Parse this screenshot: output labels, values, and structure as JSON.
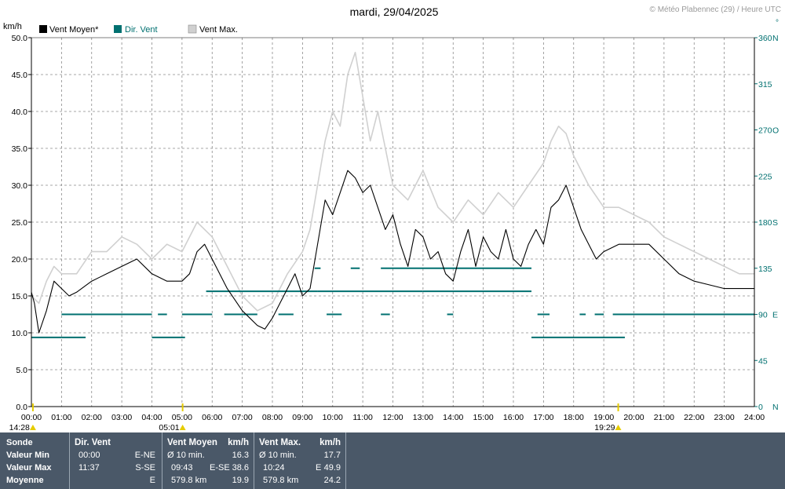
{
  "chart_data": {
    "type": "line",
    "title": "mardi, 29/04/2025",
    "credit": "© Météo Plabennec (29) / Heure UTC",
    "ylabel": "km/h",
    "legend": [
      {
        "label": "Vent Moyen*",
        "color": "#000000"
      },
      {
        "label": "Dir. Vent",
        "color": "#007070"
      },
      {
        "label": "Vent Max.",
        "color": "#d0d0d0"
      }
    ],
    "legend_placement": "top-left",
    "grid": true,
    "ylim": [
      0,
      50
    ],
    "y2lim": [
      0,
      360
    ],
    "xlim": [
      0,
      24
    ],
    "x_ticks": [
      "00:00",
      "01:00",
      "02:00",
      "03:00",
      "04:00",
      "05:00",
      "06:00",
      "07:00",
      "08:00",
      "09:00",
      "10:00",
      "11:00",
      "12:00",
      "13:00",
      "14:00",
      "15:00",
      "16:00",
      "17:00",
      "18:00",
      "19:00",
      "20:00",
      "21:00",
      "22:00",
      "23:00",
      "24:00"
    ],
    "y_ticks": [
      "0.0",
      "5.0",
      "10.0",
      "15.0",
      "20.0",
      "25.0",
      "30.0",
      "35.0",
      "40.0",
      "45.0",
      "50.0"
    ],
    "y2_ticks": [
      {
        "value": 0,
        "label": "0",
        "dir": "N"
      },
      {
        "value": 45,
        "label": "45",
        "dir": ""
      },
      {
        "value": 90,
        "label": "90",
        "dir": "E"
      },
      {
        "value": 135,
        "label": "135",
        "dir": ""
      },
      {
        "value": 180,
        "label": "180",
        "dir": "S"
      },
      {
        "value": 225,
        "label": "225",
        "dir": ""
      },
      {
        "value": 270,
        "label": "270",
        "dir": "O"
      },
      {
        "value": 315,
        "label": "315",
        "dir": ""
      },
      {
        "value": 360,
        "label": "360",
        "dir": "N"
      }
    ],
    "y2_top_mark": "°",
    "sun_events": [
      {
        "label": "14:28",
        "hour": 0.05,
        "note": "moon"
      },
      {
        "label": "05:01",
        "hour": 5.02,
        "note": "sunrise"
      },
      {
        "label": "19:29",
        "hour": 19.48,
        "note": "sunset"
      }
    ],
    "series": [
      {
        "name": "Vent Max.",
        "x": [
          0,
          0.25,
          0.5,
          0.75,
          1,
          1.5,
          2,
          2.5,
          3,
          3.5,
          4,
          4.5,
          5,
          5.5,
          6,
          6.5,
          7,
          7.5,
          8,
          8.5,
          9,
          9.25,
          9.5,
          9.75,
          10,
          10.25,
          10.5,
          10.75,
          11,
          11.25,
          11.5,
          11.75,
          12,
          12.5,
          13,
          13.5,
          14,
          14.5,
          15,
          15.5,
          16,
          16.5,
          17,
          17.25,
          17.5,
          17.75,
          18,
          18.5,
          19,
          19.5,
          20,
          20.5,
          21,
          21.5,
          22,
          22.5,
          23,
          23.5,
          24
        ],
        "values": [
          15,
          14,
          17,
          19,
          18,
          18,
          21,
          21,
          23,
          22,
          20,
          22,
          21,
          25,
          23,
          19,
          15,
          13,
          14,
          18,
          21,
          24,
          30,
          36,
          40,
          38,
          45,
          48,
          42,
          36,
          40,
          35,
          30,
          28,
          32,
          27,
          25,
          28,
          26,
          29,
          27,
          30,
          33,
          36,
          38,
          37,
          34,
          30,
          27,
          27,
          26,
          25,
          23,
          22,
          21,
          20,
          19,
          18,
          18
        ]
      },
      {
        "name": "Vent Moyen*",
        "x": [
          0,
          0.1,
          0.25,
          0.5,
          0.75,
          1,
          1.25,
          1.5,
          2,
          2.5,
          3,
          3.5,
          4,
          4.5,
          5,
          5.25,
          5.5,
          5.75,
          6,
          6.5,
          7,
          7.25,
          7.5,
          7.75,
          8,
          8.25,
          8.5,
          8.75,
          9,
          9.25,
          9.5,
          9.75,
          10,
          10.25,
          10.5,
          10.75,
          11,
          11.25,
          11.5,
          11.75,
          12,
          12.25,
          12.5,
          12.75,
          13,
          13.25,
          13.5,
          13.75,
          14,
          14.25,
          14.5,
          14.75,
          15,
          15.25,
          15.5,
          15.75,
          16,
          16.25,
          16.5,
          16.75,
          17,
          17.25,
          17.5,
          17.75,
          18,
          18.25,
          18.5,
          18.75,
          19,
          19.5,
          20,
          20.5,
          21,
          21.5,
          22,
          22.5,
          23,
          23.5,
          24
        ],
        "values": [
          15.5,
          14,
          10,
          13,
          17,
          16,
          15,
          15.5,
          17,
          18,
          19,
          20,
          18,
          17,
          17,
          18,
          21,
          22,
          20,
          16,
          13,
          12,
          11,
          10.5,
          12,
          14,
          16,
          18,
          15,
          16,
          22,
          28,
          26,
          29,
          32,
          31,
          29,
          30,
          27,
          24,
          26,
          22,
          19,
          24,
          23,
          20,
          21,
          18,
          17,
          21,
          24,
          19,
          23,
          21,
          20,
          24,
          20,
          19,
          22,
          24,
          22,
          27,
          28,
          30,
          27,
          24,
          22,
          20,
          21,
          22,
          22,
          22,
          20,
          18,
          17,
          16.5,
          16,
          16,
          16
        ]
      },
      {
        "name": "Dir. Vent",
        "segments": [
          {
            "start": 0,
            "end": 1.0,
            "deg": 67.5
          },
          {
            "start": 1.0,
            "end": 1.8,
            "deg": 67.5
          },
          {
            "start": 4.0,
            "end": 5.1,
            "deg": 67.5
          },
          {
            "start": 1.0,
            "end": 4.0,
            "deg": 90
          },
          {
            "start": 4.2,
            "end": 4.5,
            "deg": 90
          },
          {
            "start": 5.0,
            "end": 6.0,
            "deg": 90
          },
          {
            "start": 6.4,
            "end": 7.5,
            "deg": 90
          },
          {
            "start": 5.8,
            "end": 9.5,
            "deg": 112.5
          },
          {
            "start": 9.5,
            "end": 13.0,
            "deg": 112.5
          },
          {
            "start": 13.0,
            "end": 16.6,
            "deg": 112.5
          },
          {
            "start": 11.6,
            "end": 16.6,
            "deg": 135
          },
          {
            "start": 9.4,
            "end": 9.6,
            "deg": 135
          },
          {
            "start": 10.6,
            "end": 10.9,
            "deg": 135
          },
          {
            "start": 8.2,
            "end": 8.7,
            "deg": 90
          },
          {
            "start": 9.8,
            "end": 10.3,
            "deg": 90
          },
          {
            "start": 11.6,
            "end": 11.9,
            "deg": 90
          },
          {
            "start": 13.8,
            "end": 14.0,
            "deg": 90
          },
          {
            "start": 16.8,
            "end": 17.2,
            "deg": 90
          },
          {
            "start": 18.2,
            "end": 18.4,
            "deg": 90
          },
          {
            "start": 18.7,
            "end": 19.0,
            "deg": 90
          },
          {
            "start": 19.3,
            "end": 24.0,
            "deg": 90
          },
          {
            "start": 16.6,
            "end": 19.7,
            "deg": 67.5
          }
        ]
      }
    ]
  },
  "stats": {
    "block1": {
      "row_labels": [
        "Sonde",
        "Valeur Min",
        "Valeur Max",
        "Moyenne"
      ]
    },
    "block2": {
      "header": "Dir. Vent",
      "rows": [
        [
          "00:00",
          "E-NE"
        ],
        [
          "11:37",
          "S-SE"
        ],
        [
          "",
          "E"
        ]
      ]
    },
    "block3": {
      "header": "Vent Moyen",
      "unit": "km/h",
      "rows": [
        [
          "Ø 10 min.",
          "",
          "16.3"
        ],
        [
          "09:43",
          "E-SE",
          "38.6"
        ],
        [
          "579.8 km",
          "",
          "19.9"
        ]
      ]
    },
    "block4": {
      "header": "Vent Max.",
      "unit": "km/h",
      "rows": [
        [
          "Ø 10 min.",
          "",
          "17.7"
        ],
        [
          "10:24",
          "E",
          "49.9"
        ],
        [
          "579.8 km",
          "",
          "24.2"
        ]
      ]
    }
  }
}
